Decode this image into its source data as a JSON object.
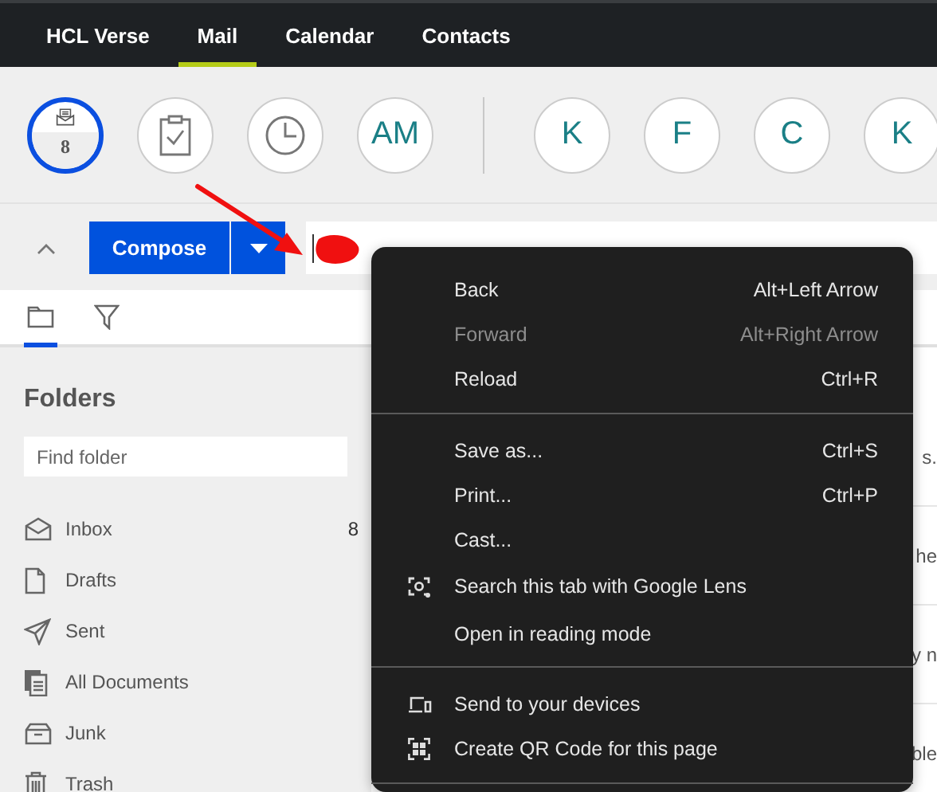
{
  "top_nav": {
    "tabs": [
      {
        "label": "HCL Verse",
        "selected": false
      },
      {
        "label": "Mail",
        "selected": true
      },
      {
        "label": "Calendar",
        "selected": false
      },
      {
        "label": "Contacts",
        "selected": false
      }
    ]
  },
  "bubbles": {
    "items": [
      {
        "kind": "inbox",
        "count": "8",
        "selected": true
      },
      {
        "kind": "tasks",
        "selected": false
      },
      {
        "kind": "clock",
        "selected": false
      },
      {
        "kind": "initials",
        "label": "AM",
        "selected": false
      }
    ],
    "people": [
      {
        "label": "K",
        "selected": false
      },
      {
        "label": "F",
        "selected": false
      },
      {
        "label": "C",
        "selected": false
      },
      {
        "label": "K",
        "selected": false
      }
    ]
  },
  "compose": {
    "label": "Compose"
  },
  "sidebar": {
    "view_tabs": [
      {
        "kind": "folder",
        "selected": true
      },
      {
        "kind": "filter",
        "selected": false
      }
    ],
    "title": "Folders",
    "search": {
      "placeholder": "Find folder"
    },
    "folders": [
      {
        "kind": "inbox",
        "label": "Inbox",
        "count": "8"
      },
      {
        "kind": "drafts",
        "label": "Drafts"
      },
      {
        "kind": "sent",
        "label": "Sent"
      },
      {
        "kind": "documents",
        "label": "All Documents"
      },
      {
        "kind": "junk",
        "label": "Junk"
      },
      {
        "kind": "trash",
        "label": "Trash"
      }
    ]
  },
  "message_list": {
    "snippets": [
      "s.",
      "he",
      "y n",
      "ble"
    ]
  },
  "context_menu": {
    "sections": [
      [
        {
          "kind": "plain",
          "label": "Back",
          "shortcut": "Alt+Left Arrow",
          "disabled": false
        },
        {
          "kind": "plain",
          "label": "Forward",
          "shortcut": "Alt+Right Arrow",
          "disabled": true
        },
        {
          "kind": "plain",
          "label": "Reload",
          "shortcut": "Ctrl+R",
          "disabled": false
        }
      ],
      [
        {
          "kind": "plain",
          "label": "Save as...",
          "shortcut": "Ctrl+S",
          "disabled": false
        },
        {
          "kind": "plain",
          "label": "Print...",
          "shortcut": "Ctrl+P",
          "disabled": false
        },
        {
          "kind": "plain",
          "label": "Cast...",
          "disabled": false
        },
        {
          "kind": "lens",
          "label": "Search this tab with Google Lens",
          "disabled": false
        },
        {
          "kind": "plain",
          "label": "Open in reading mode",
          "disabled": false
        }
      ],
      [
        {
          "kind": "devices",
          "label": "Send to your devices",
          "disabled": false
        },
        {
          "kind": "qr",
          "label": "Create QR Code for this page",
          "disabled": false
        }
      ]
    ]
  }
}
